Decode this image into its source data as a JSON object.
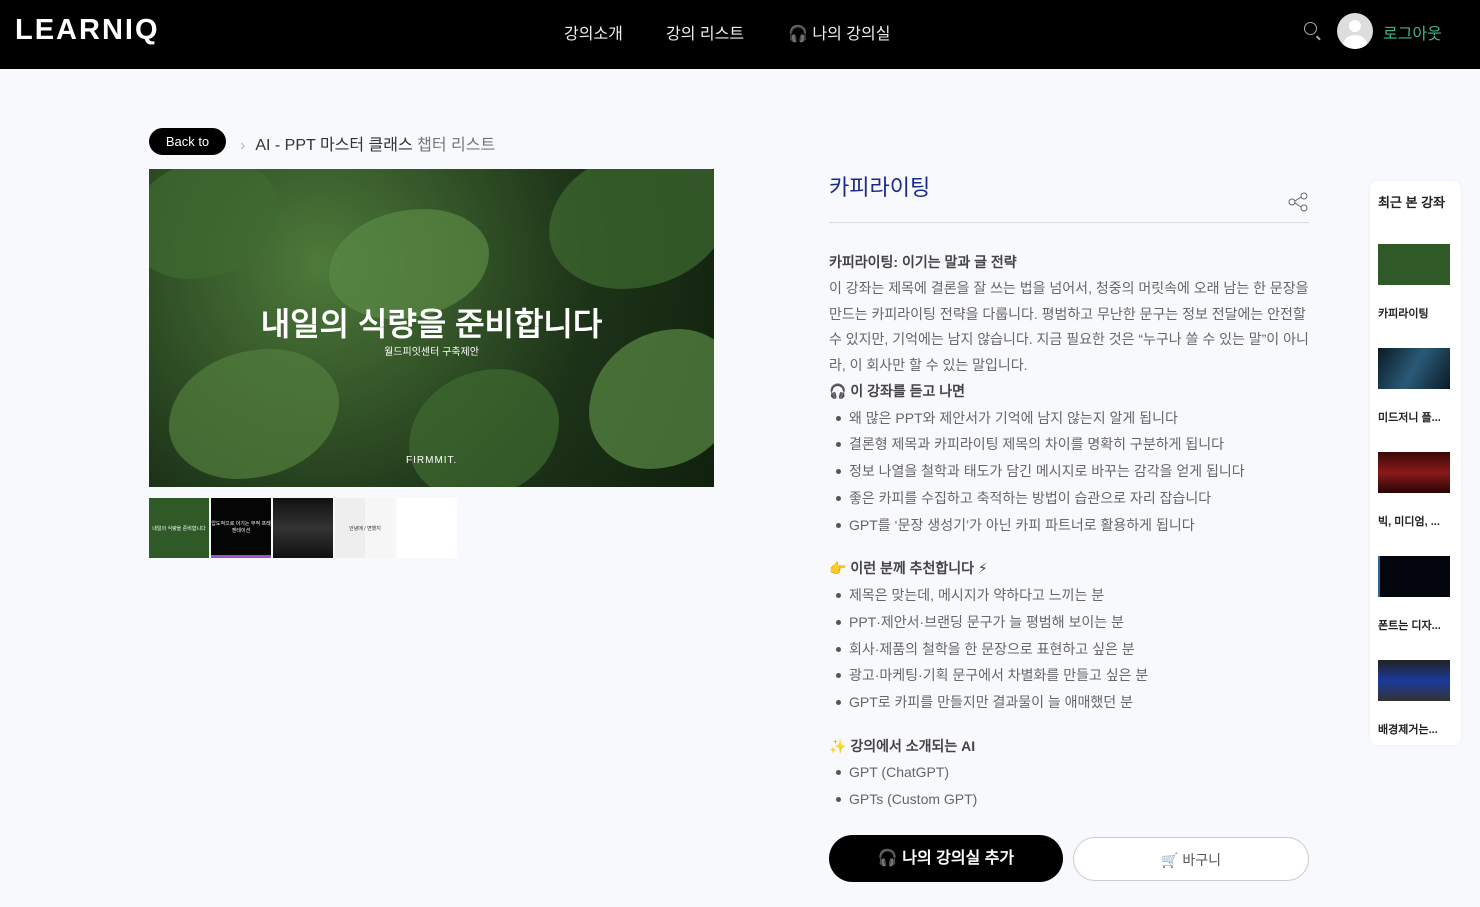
{
  "nav": {
    "logo": "LEARNIQ",
    "items": [
      "강의소개",
      "강의 리스트",
      "나의 강의실"
    ],
    "logout": "로그아웃"
  },
  "breadcrumb": {
    "back": "Back to",
    "course": "AI - PPT 마스터 클래스",
    "page": "챕터 리스트"
  },
  "hero": {
    "title": "내일의 식량을 준비합니다",
    "subtitle": "월드피잇센터 구축제안",
    "brand": "FIRMMIT."
  },
  "thumbnails": [
    "내일의 식량을 준비합니다",
    "압도적으로 이기는 무적 프레젠테이션",
    "",
    "안녕에 / 변했지",
    ""
  ],
  "lecture": {
    "title": "카피라이팅",
    "heading": "카피라이팅: 이기는 말과 글 전략",
    "description": "이 강좌는 제목에 결론을 잘 쓰는 법을 넘어서, 청중의 머릿속에 오래 남는 한 문장을 만드는 카피라이팅 전략을 다룹니다. 평범하고 무난한 문구는 정보 전달에는 안전할 수 있지만, 기억에는 남지 않습니다. 지금 필요한 것은 “누구나 쓸 수 있는 말”이 아니라, 이 회사만 할 수 있는 말입니다.",
    "after_title": "이 강좌를 듣고 나면",
    "after": [
      "왜 많은 PPT와 제안서가 기억에 남지 않는지 알게 됩니다",
      "결론형 제목과 카피라이팅 제목의 차이를 명확히 구분하게 됩니다",
      "정보 나열을 철학과 태도가 담긴 메시지로 바꾸는 감각을 얻게 됩니다",
      "좋은 카피를 수집하고 축적하는 방법이 습관으로 자리 잡습니다",
      "GPT를 ‘문장 생성기’가 아닌 카피 파트너로 활용하게 됩니다"
    ],
    "target_title": "이런 분께 추천합니다",
    "target": [
      "제목은 맞는데, 메시지가 약하다고 느끼는 분",
      "PPT·제안서·브랜딩 문구가 늘 평범해 보이는 분",
      "회사·제품의 철학을 한 문장으로 표현하고 싶은 분",
      "광고·마케팅·기획 문구에서 차별화를 만들고 싶은 분",
      "GPT로 카피를 만들지만 결과물이 늘 애매했던 분"
    ],
    "ai_title": "강의에서 소개되는 AI",
    "ai": [
      "GPT (ChatGPT)",
      "GPTs (Custom GPT)"
    ],
    "add_button": "나의 강의실 추가",
    "cart_button": "바구니"
  },
  "recent": {
    "title": "최근 본 강좌",
    "items": [
      "카피라이팅",
      "미드저니 플...",
      "빅, 미디엄, ...",
      "폰트는 디자...",
      "배경제거는..."
    ]
  }
}
